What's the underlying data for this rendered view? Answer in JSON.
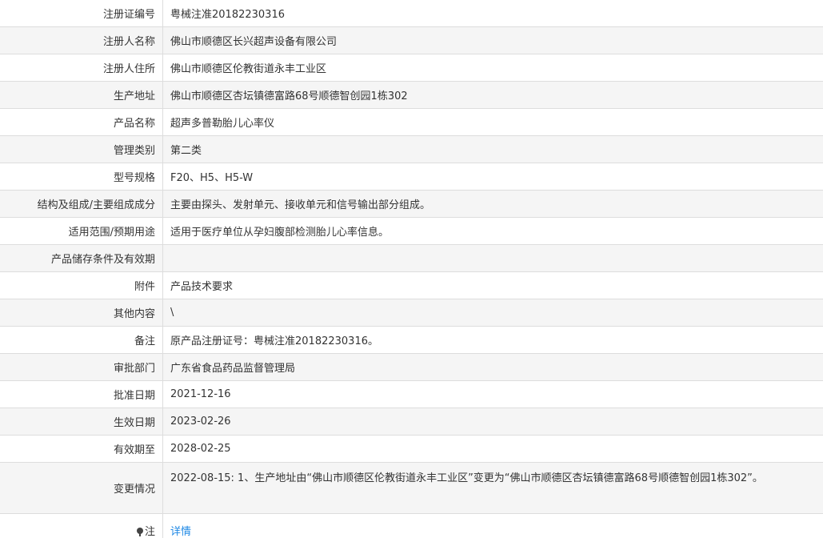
{
  "rows": [
    {
      "label": "注册证编号",
      "value": "粤械注准20182230316"
    },
    {
      "label": "注册人名称",
      "value": "佛山市顺德区长兴超声设备有限公司"
    },
    {
      "label": "注册人住所",
      "value": "佛山市顺德区伦教街道永丰工业区"
    },
    {
      "label": "生产地址",
      "value": "佛山市顺德区杏坛镇德富路68号顺德智创园1栋302"
    },
    {
      "label": "产品名称",
      "value": "超声多普勒胎儿心率仪"
    },
    {
      "label": "管理类别",
      "value": "第二类"
    },
    {
      "label": "型号规格",
      "value": "F20、H5、H5-W"
    },
    {
      "label": "结构及组成/主要组成成分",
      "value": "主要由探头、发射单元、接收单元和信号输出部分组成。"
    },
    {
      "label": "适用范围/预期用途",
      "value": "适用于医疗单位从孕妇腹部检测胎儿心率信息。"
    },
    {
      "label": "产品储存条件及有效期",
      "value": ""
    },
    {
      "label": "附件",
      "value": "产品技术要求"
    },
    {
      "label": "其他内容",
      "value": "\\"
    },
    {
      "label": "备注",
      "value": "原产品注册证号：粤械注准20182230316。"
    },
    {
      "label": "审批部门",
      "value": "广东省食品药品监督管理局"
    },
    {
      "label": "批准日期",
      "value": "2021-12-16"
    },
    {
      "label": "生效日期",
      "value": "2023-02-26"
    },
    {
      "label": "有效期至",
      "value": "2028-02-25"
    },
    {
      "label": "变更情况",
      "value": "2022-08-15: 1、生产地址由“佛山市顺德区伦教街道永丰工业区”变更为“佛山市顺德区杏坛镇德富路68号顺德智创园1栋302”。"
    }
  ],
  "note": {
    "label": "注",
    "icon": "pin-icon",
    "link_text": "详情"
  }
}
